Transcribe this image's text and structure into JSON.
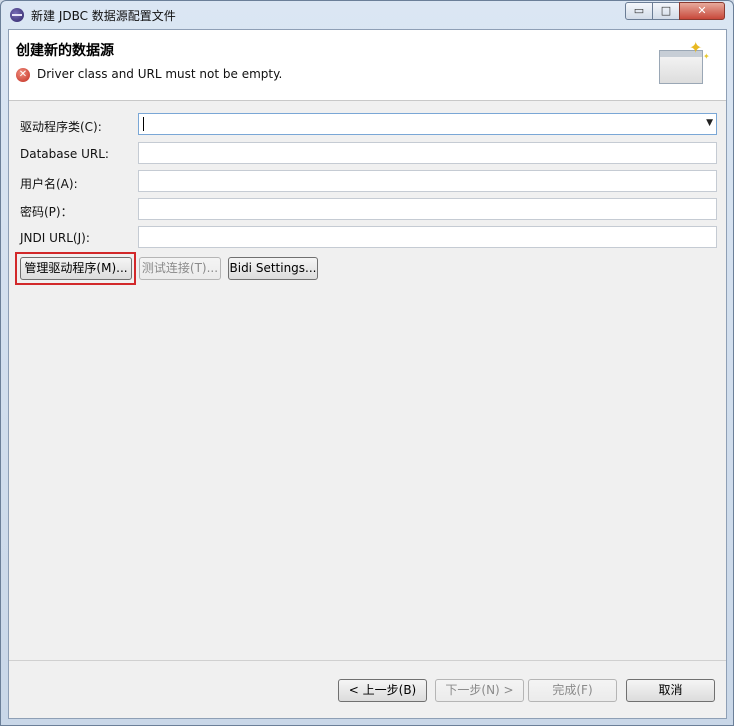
{
  "window": {
    "title": "新建 JDBC 数据源配置文件",
    "controls": {
      "minimize": "▭",
      "maximize": "□",
      "close": "✕"
    }
  },
  "header": {
    "title": "创建新的数据源",
    "message": "Driver class and URL must not be empty.",
    "message_icon": "error-icon"
  },
  "form": {
    "driver_class": {
      "label": "驱动程序类(C):",
      "value": ""
    },
    "database_url": {
      "label": "Database URL:",
      "value": ""
    },
    "username": {
      "label": "用户名(A):",
      "value": ""
    },
    "password": {
      "label": "密码(P)：",
      "value": ""
    },
    "jndi_url": {
      "label": "JNDI URL(J):",
      "value": ""
    }
  },
  "actions": {
    "manage_drivers": "管理驱动程序(M)...",
    "test_connection": "测试连接(T)...",
    "bidi_settings": "Bidi Settings..."
  },
  "footer": {
    "back": "< 上一步(B)",
    "next": "下一步(N) >",
    "finish": "完成(F)",
    "cancel": "取消"
  }
}
